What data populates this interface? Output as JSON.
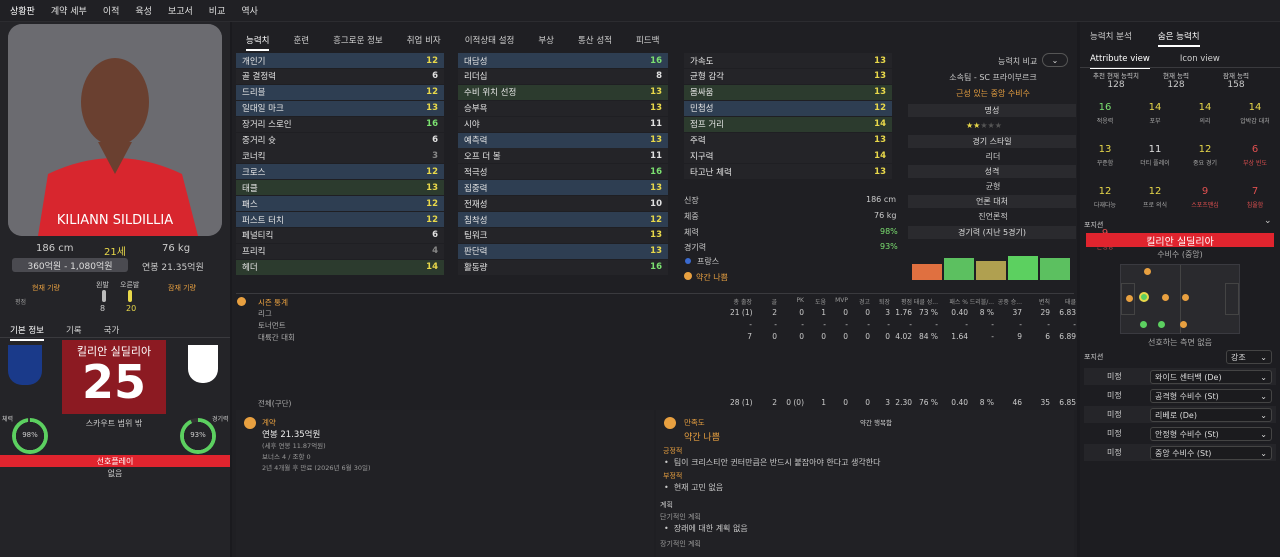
{
  "nav": [
    "상황판",
    "계약 세부",
    "이적",
    "육성",
    "보고서",
    "비교",
    "역사"
  ],
  "left": {
    "height": "186 cm",
    "age": "21세",
    "weight": "76 kg",
    "value": "360억원 - 1,080억원",
    "wage": "연봉 21.35억원",
    "current_ability_label": "현재 기량",
    "potential_ability_label": "잠재 기량",
    "left_foot_label": "왼발",
    "right_foot_label": "오른발",
    "left_foot_val": "8",
    "right_foot_val": "20",
    "tabs": [
      "기본 정보",
      "기록",
      "국가"
    ],
    "name": "킬리안 실딜리아",
    "number": "25",
    "scout_range": "스카우트 범위 밖",
    "fitness_label": "체력",
    "fitness_val": "98%",
    "match_sharp_label": "경기력",
    "match_sharp_val": "93%",
    "pref_play_label": "선호플레이",
    "pref_play_val": "없음",
    "fitness_pct": 98,
    "match_pct": 93
  },
  "mid": {
    "tabs": [
      "능력치",
      "훈련",
      "흥그로운 정보",
      "취업 비자",
      "이적상태 설정",
      "부상",
      "통산 성적",
      "피드백"
    ],
    "col1": [
      [
        "개인기",
        "12",
        "hlb"
      ],
      [
        "골 결정력",
        "6",
        "nrm"
      ],
      [
        "드리블",
        "12",
        "hlb"
      ],
      [
        "일대일 마크",
        "13",
        "hlb"
      ],
      [
        "장거리 스로인",
        "16",
        "nrm"
      ],
      [
        "중거리 슛",
        "6",
        "nrm"
      ],
      [
        "코너킥",
        "3",
        "nrm"
      ],
      [
        "크로스",
        "12",
        "hlb"
      ],
      [
        "태클",
        "13",
        "hlg"
      ],
      [
        "패스",
        "12",
        "hlb"
      ],
      [
        "퍼스트 터치",
        "12",
        "hlb"
      ],
      [
        "페널티킥",
        "6",
        "nrm"
      ],
      [
        "프리킥",
        "4",
        "nrm"
      ],
      [
        "헤더",
        "14",
        "hlg"
      ]
    ],
    "col2": [
      [
        "대담성",
        "16",
        "hlb"
      ],
      [
        "리더십",
        "8",
        "nrm"
      ],
      [
        "수비 위치 선정",
        "13",
        "hlg"
      ],
      [
        "승부욕",
        "13",
        "nrm"
      ],
      [
        "시야",
        "11",
        "nrm"
      ],
      [
        "예측력",
        "13",
        "hlb"
      ],
      [
        "오프 더 볼",
        "11",
        "nrm"
      ],
      [
        "적극성",
        "16",
        "nrm"
      ],
      [
        "집중력",
        "13",
        "hlb"
      ],
      [
        "전재성",
        "10",
        "nrm"
      ],
      [
        "침착성",
        "12",
        "hlb"
      ],
      [
        "팀워크",
        "13",
        "nrm"
      ],
      [
        "판단력",
        "13",
        "hlb"
      ],
      [
        "활동량",
        "16",
        "nrm"
      ]
    ],
    "col3": [
      [
        "가속도",
        "13",
        "nrm"
      ],
      [
        "균형 감각",
        "13",
        "nrm"
      ],
      [
        "몸싸움",
        "13",
        "hlg"
      ],
      [
        "민첩성",
        "12",
        "hlb"
      ],
      [
        "점프 거리",
        "14",
        "hlg"
      ],
      [
        "주력",
        "13",
        "nrm"
      ],
      [
        "지구력",
        "14",
        "nrm"
      ],
      [
        "타고난 체력",
        "13",
        "nrm"
      ]
    ],
    "phys": {
      "height_label": "신장",
      "height": "186 cm",
      "weight_label": "체중",
      "weight": "76 kg",
      "fitness_label": "체력",
      "fitness": "98%",
      "match_label": "경기력",
      "match": "93%",
      "nation_label": "프랑스",
      "morale": "약간 나쁨"
    },
    "compare": {
      "button": "능력치 비교",
      "club": "소속팀 - SC 프라이부르크",
      "role": "근성 있는 중앙 수비수",
      "rep_label": "명성",
      "style_label": "경기 스타일",
      "style": "리더",
      "personality_label": "성격",
      "personality": "균형",
      "media_label": "언론 대처",
      "media": "진언론적",
      "form_label": "경기력 (지난 5경기)"
    },
    "stats_header": {
      "title": "시즌 통계",
      "cols": [
        "총 출장",
        "골",
        "PK",
        "도움",
        "MVP",
        "경고",
        "퇴장",
        "평점",
        "태클 성...",
        "패스 %",
        "드리블/...",
        "공중 승...",
        "변칙",
        "태클",
        "평점"
      ]
    },
    "stats_rows": [
      [
        "리그",
        "21 (1)",
        "2",
        "0",
        "1",
        "0",
        "0",
        "3",
        "1.76",
        "73 %",
        "0.40",
        "8 %",
        "37",
        "29",
        "6.83"
      ],
      [
        "토너먼트",
        "-",
        "-",
        "-",
        "-",
        "-",
        "-",
        "-",
        "-",
        "-",
        "-",
        "-",
        "-",
        "-",
        "-"
      ],
      [
        "대륙간 대회",
        "7",
        "0",
        "0",
        "0",
        "0",
        "0",
        "0",
        "4.02",
        "84 %",
        "1.64",
        "-",
        "9",
        "6",
        "6.89"
      ]
    ],
    "stats_total": [
      "전체(구단)",
      "28 (1)",
      "2",
      "0 (0)",
      "1",
      "0",
      "0",
      "3",
      "2.30",
      "76 %",
      "0.40",
      "8 %",
      "46",
      "35",
      "6.85"
    ],
    "contract": {
      "title": "계약",
      "salary": "연봉 21.35억원",
      "sub1": "(세후 연봉 11.87억원)",
      "sub2": "보너스 4 / 조항 0",
      "sub3": "2년 4개월 후 만료 (2026년 6월 30일)"
    },
    "happiness": {
      "title": "만족도",
      "sub": "약간 행복함",
      "value": "약간 나쁨",
      "pos_label": "긍정적",
      "pos1": "팀이 크리스티안 귄터만큼은 반드시 붙잡아야 한다고 생각한다",
      "neg_label": "부정적",
      "neg1": "현재 고민 없음",
      "plans_label": "계획",
      "short_label": "단기적인 계획",
      "short1": "장래에 대한 계획 없음",
      "long_label": "장기적인 계획"
    }
  },
  "right": {
    "tabs": [
      "능력치 분석",
      "숨은 능력치"
    ],
    "subtabs": [
      "Attribute view",
      "Icon view"
    ],
    "cols": [
      "추천 현재 능력치",
      "현재 능력",
      "잠재 능력"
    ],
    "vals": [
      "128",
      "128",
      "158"
    ],
    "hidden": [
      [
        "16",
        "적응력"
      ],
      [
        "14",
        "포부"
      ],
      [
        "14",
        "의리"
      ],
      [
        "14",
        "압박감 대처"
      ],
      [
        "13",
        "꾸준함"
      ],
      [
        "11",
        "더티 플레이"
      ],
      [
        "12",
        "중요 경기"
      ],
      [
        "6",
        "부상 빈도"
      ],
      [
        "12",
        "다재다능"
      ],
      [
        "12",
        "프로 의식"
      ],
      [
        "9",
        "스포츠맨십"
      ],
      [
        "7",
        "침울함"
      ],
      [
        "9",
        "논쟁성"
      ]
    ],
    "positions_title": "포지션",
    "player": "킬리안 실딜리아",
    "position": "수비수 (중앙)",
    "pitch_caption": "선호하는 측면 없음",
    "pref_title": "포지션",
    "strength": "강조",
    "roles": [
      [
        "미정",
        "와이드 센터백 (De)"
      ],
      [
        "미정",
        "공격형 수비수 (St)"
      ],
      [
        "미정",
        "리베로 (De)"
      ],
      [
        "미정",
        "안정형 수비수 (St)"
      ],
      [
        "미정",
        "중앙 수비수 (St)"
      ]
    ]
  },
  "colors": {
    "accent_red": "#e0242e",
    "yellow": "#e8d84a",
    "green": "#7be070"
  }
}
